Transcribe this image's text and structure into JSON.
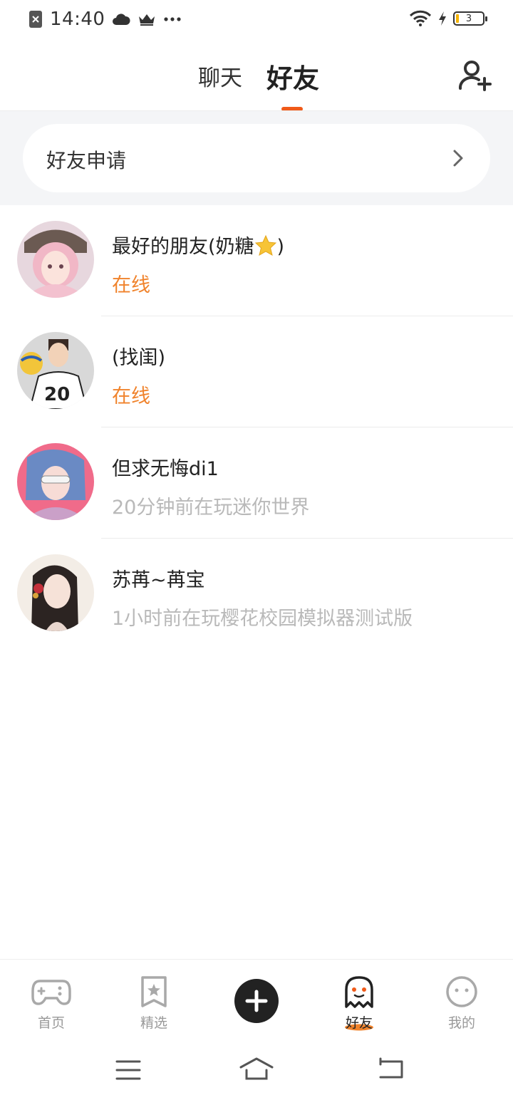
{
  "status_bar": {
    "time": "14:40",
    "battery_level": "3",
    "icons": [
      "app-close-icon",
      "cloud-icon",
      "crown-icon",
      "more-icon",
      "wifi-icon",
      "charging-icon",
      "battery-icon"
    ]
  },
  "header": {
    "tabs": [
      {
        "label": "聊天",
        "active": false
      },
      {
        "label": "好友",
        "active": true
      }
    ],
    "accent_color": "#f05a19"
  },
  "friend_request": {
    "label": "好友申请"
  },
  "friends": [
    {
      "name": "最好的朋友(奶糖",
      "name_suffix": ")",
      "has_star_emoji": true,
      "status": "在线",
      "online": true
    },
    {
      "name": "(找闺)",
      "status": "在线",
      "online": true
    },
    {
      "name": "但求无悔di1",
      "status": "20分钟前在玩迷你世界",
      "online": false
    },
    {
      "name": "苏苒~苒宝",
      "status": "1小时前在玩樱花校园模拟器测试版",
      "online": false
    }
  ],
  "bottom_nav": {
    "items": [
      {
        "label": "首页",
        "icon": "gamepad-icon",
        "active": false
      },
      {
        "label": "精选",
        "icon": "star-bookmark-icon",
        "active": false
      },
      {
        "label": "",
        "icon": "plus-icon",
        "active": false
      },
      {
        "label": "好友",
        "icon": "ghost-icon",
        "active": true
      },
      {
        "label": "我的",
        "icon": "face-icon",
        "active": false
      }
    ]
  },
  "colors": {
    "online_status": "#f0832c",
    "offline_status": "#b9b9b9",
    "section_bg": "#f4f5f7"
  }
}
